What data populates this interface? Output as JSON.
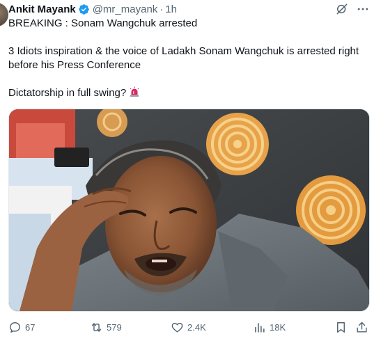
{
  "tweet": {
    "author": {
      "display_name": "Ankit Mayank",
      "handle": "@mr_mayank",
      "time": "1h",
      "verified_icon": "verified-badge-icon"
    },
    "separator": "·",
    "text": {
      "line1": "BREAKING : Sonam Wangchuk arrested",
      "line2": "3 Idiots inspiration & the voice of Ladakh Sonam Wangchuk is arrested right before his Press Conference",
      "line3": "Dictatorship in full swing?",
      "emoji": "rotating-light-emoji"
    },
    "media": {
      "type": "photo"
    },
    "stats": {
      "replies": "67",
      "reposts": "579",
      "likes": "2.4K",
      "views": "18K"
    }
  },
  "colors": {
    "text_primary": "#0f1419",
    "text_secondary": "#536471",
    "verified_blue": "#1d9bf0"
  }
}
